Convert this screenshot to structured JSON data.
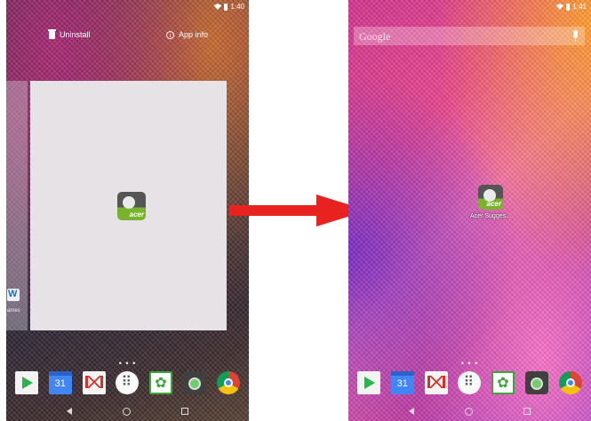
{
  "left_screen": {
    "status": {
      "time": "1:40"
    },
    "actions": {
      "uninstall": "Uninstall",
      "app_info": "App info"
    },
    "side_page": {
      "app_label": "ames"
    },
    "page_dots": "• • •"
  },
  "right_screen": {
    "status": {
      "time": "1:41"
    },
    "search": {
      "placeholder": "Google"
    },
    "home_app": {
      "label": "Acer Sugges..."
    },
    "page_dots": "• • •"
  },
  "dock": {
    "icons": [
      "play-store-icon",
      "calendar-icon",
      "gmail-icon",
      "app-drawer-icon",
      "gallery-icon",
      "camera-icon",
      "chrome-icon"
    ],
    "calendar_day": "31"
  },
  "arrow_color": "#e8231f",
  "icon_text": {
    "acer": "acer"
  }
}
